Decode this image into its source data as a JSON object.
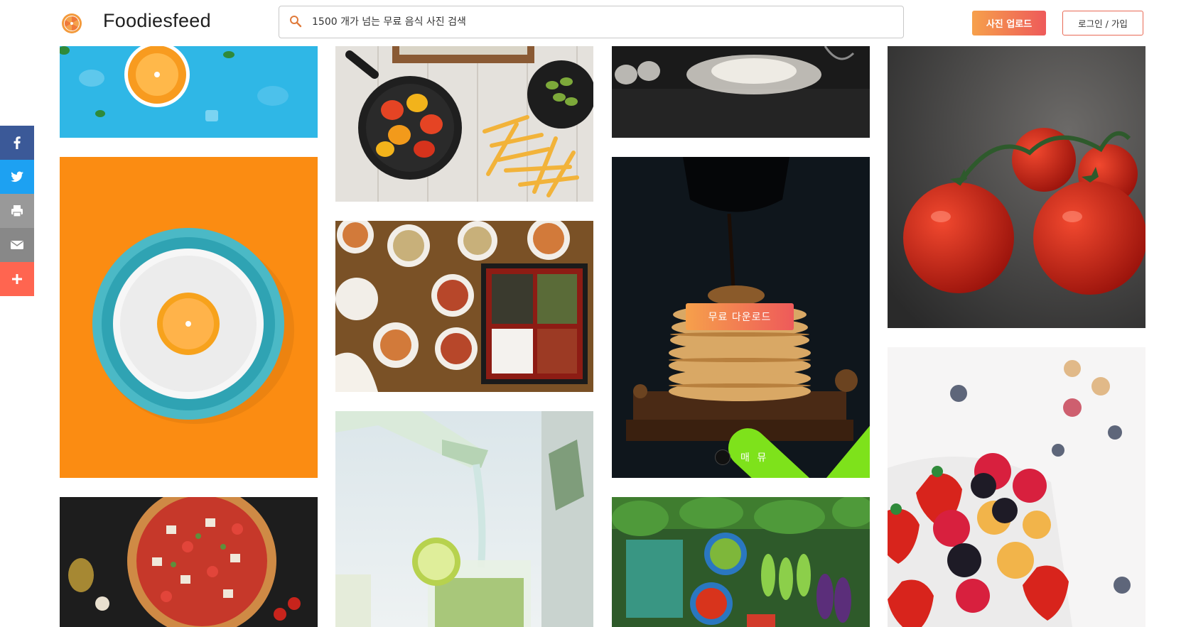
{
  "header": {
    "brand": "Foodiesfeed",
    "search_placeholder": "1500 개가 넘는 무료 음식 사진 검색",
    "upload_label": "사진 업로드",
    "login_label": "로그인 / 가입"
  },
  "share": [
    {
      "name": "facebook-icon",
      "color": "#3b5998"
    },
    {
      "name": "twitter-icon",
      "color": "#1da1f2"
    },
    {
      "name": "print-icon",
      "color": "#999999"
    },
    {
      "name": "email-icon",
      "color": "#888888"
    },
    {
      "name": "plus-icon",
      "color": "#ff6550"
    }
  ],
  "featured": {
    "download_label": "무료 다운로드",
    "author_name": "매 뮤"
  },
  "photos": [
    "orange-on-blue",
    "orange-bowl-on-orange",
    "pizza",
    "peppers-and-fries",
    "korean-table",
    "water-pouring",
    "flour-and-eggs",
    "pancakes-syrup",
    "vegetable-market",
    "tomatoes",
    "berries-bowl"
  ]
}
